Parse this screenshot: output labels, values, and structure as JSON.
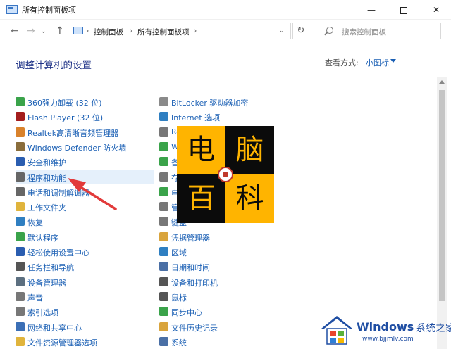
{
  "window": {
    "title": "所有控制面板项",
    "minimize": "—",
    "close": "✕"
  },
  "address": {
    "crumbs": [
      "控制面板",
      "所有控制面板项"
    ],
    "search_placeholder": "搜索控制面板"
  },
  "header": {
    "title": "调整计算机的设置",
    "view_by_label": "查看方式:",
    "view_by_value": "小图标"
  },
  "left_items": [
    {
      "label": "360强力卸载 (32 位)",
      "icon_color": "#3aa34a",
      "icon": "uninstall-icon"
    },
    {
      "label": "Flash Player (32 位)",
      "icon_color": "#a31d1d",
      "icon": "flash-icon"
    },
    {
      "label": "Realtek高清晰音频管理器",
      "icon_color": "#d9822b",
      "icon": "audio-manager-icon"
    },
    {
      "label": "Windows Defender 防火墙",
      "icon_color": "#8a6d3b",
      "icon": "firewall-icon"
    },
    {
      "label": "安全和维护",
      "icon_color": "#2a5db0",
      "icon": "flag-icon"
    },
    {
      "label": "程序和功能",
      "icon_color": "#666666",
      "icon": "programs-icon"
    },
    {
      "label": "电话和调制解调器",
      "icon_color": "#666666",
      "icon": "phone-icon"
    },
    {
      "label": "工作文件夹",
      "icon_color": "#e0b43c",
      "icon": "folder-icon"
    },
    {
      "label": "恢复",
      "icon_color": "#2f7fc1",
      "icon": "recovery-icon"
    },
    {
      "label": "默认程序",
      "icon_color": "#3aa34a",
      "icon": "default-programs-icon"
    },
    {
      "label": "轻松使用设置中心",
      "icon_color": "#2a5db0",
      "icon": "ease-of-access-icon"
    },
    {
      "label": "任务栏和导航",
      "icon_color": "#555555",
      "icon": "taskbar-icon"
    },
    {
      "label": "设备管理器",
      "icon_color": "#5c6f80",
      "icon": "device-manager-icon"
    },
    {
      "label": "声音",
      "icon_color": "#777777",
      "icon": "speaker-icon"
    },
    {
      "label": "索引选项",
      "icon_color": "#777777",
      "icon": "index-icon"
    },
    {
      "label": "网络和共享中心",
      "icon_color": "#3b6fb6",
      "icon": "network-icon"
    },
    {
      "label": "文件资源管理器选项",
      "icon_color": "#e0b43c",
      "icon": "folder-options-icon"
    }
  ],
  "right_items": [
    {
      "label": "BitLocker 驱动器加密",
      "icon_color": "#8a8a8a",
      "icon": "bitlocker-icon"
    },
    {
      "label": "Internet 选项",
      "icon_color": "#2f7fc1",
      "icon": "internet-icon"
    },
    {
      "label": "Re",
      "icon_color": "#777777",
      "icon": "remote-icon"
    },
    {
      "label": "W",
      "icon_color": "#3aa34a",
      "icon": "windows-icon"
    },
    {
      "label": "备",
      "icon_color": "#3aa34a",
      "icon": "backup-icon"
    },
    {
      "label": "存",
      "icon_color": "#777777",
      "icon": "storage-icon"
    },
    {
      "label": "电",
      "icon_color": "#3aa34a",
      "icon": "power-icon"
    },
    {
      "label": "管",
      "icon_color": "#777777",
      "icon": "admin-tools-icon"
    },
    {
      "label": "键盘",
      "icon_color": "#777777",
      "icon": "keyboard-icon"
    },
    {
      "label": "凭据管理器",
      "icon_color": "#d9a43c",
      "icon": "credential-icon"
    },
    {
      "label": "区域",
      "icon_color": "#2f7fc1",
      "icon": "region-icon"
    },
    {
      "label": "日期和时间",
      "icon_color": "#4a6fa5",
      "icon": "clock-icon"
    },
    {
      "label": "设备和打印机",
      "icon_color": "#555555",
      "icon": "printer-icon"
    },
    {
      "label": "鼠标",
      "icon_color": "#555555",
      "icon": "mouse-icon"
    },
    {
      "label": "同步中心",
      "icon_color": "#3aa34a",
      "icon": "sync-icon"
    },
    {
      "label": "文件历史记录",
      "icon_color": "#d9a43c",
      "icon": "file-history-icon"
    },
    {
      "label": "系统",
      "icon_color": "#4a6fa5",
      "icon": "system-icon"
    }
  ],
  "overlay_logo": {
    "chars": [
      "电",
      "脑",
      "百",
      "科"
    ],
    "dark": "#0b0b0b",
    "accent": "#ffb400"
  },
  "watermark": {
    "brand": "Windows",
    "brand_suffix": "系统之家",
    "url": "www.bjjmlv.com",
    "color": "#1f4ea3"
  },
  "colors": {
    "link": "#1a5fb4",
    "heading": "#1e3287",
    "highlight": "#e5f0fb",
    "arrow": "#e23a3a"
  }
}
